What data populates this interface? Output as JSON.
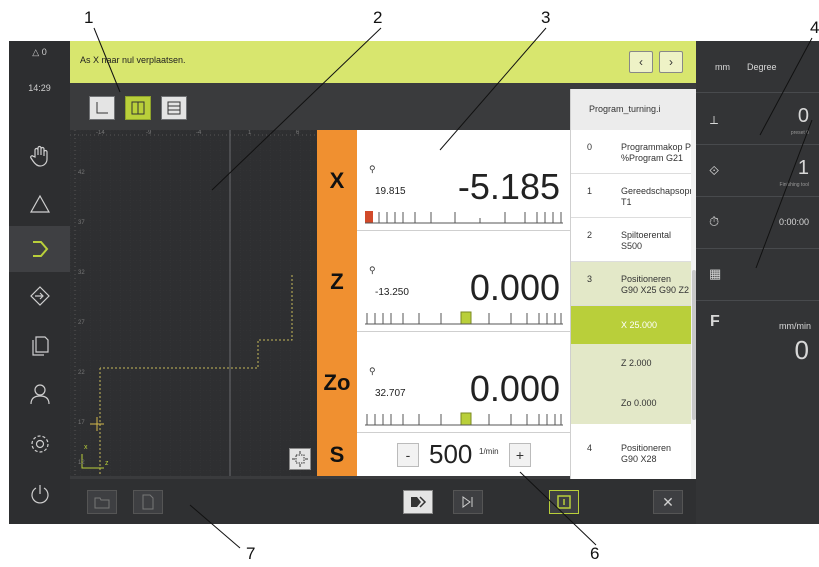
{
  "callouts": [
    "1",
    "2",
    "3",
    "4",
    "5",
    "6",
    "7"
  ],
  "status": {
    "alarm_count": "0",
    "time": "14:29"
  },
  "message": {
    "text": "As X naar nul verplaatsen."
  },
  "units": {
    "length": "mm",
    "angle": "Degree"
  },
  "right_panel": {
    "preset": {
      "value": "0",
      "label": "preset 0"
    },
    "tool": {
      "value": "1",
      "label": "Finishing tool"
    },
    "timer": {
      "value": "0:00:00"
    },
    "feed": {
      "letter": "F",
      "unit": "mm/min",
      "value": "0"
    }
  },
  "axes": [
    {
      "name": "X",
      "ref": "19.815",
      "value": "-5.185"
    },
    {
      "name": "Z",
      "ref": "-13.250",
      "value": "0.000"
    },
    {
      "name": "Zo",
      "ref": "32.707",
      "value": "0.000"
    }
  ],
  "spindle": {
    "name": "S",
    "minus": "-",
    "value": "500",
    "unit": "1/min",
    "plus": "+"
  },
  "program": {
    "title": "Program_turning.i",
    "steps": [
      {
        "num": "0",
        "line1": "Programmakop Pro",
        "line2": "%Program G21"
      },
      {
        "num": "1",
        "line1": "Gereedschapsopro",
        "line2": "T1"
      },
      {
        "num": "2",
        "line1": "Spiltoerental",
        "line2": "S500"
      },
      {
        "num": "3",
        "line1": "Positioneren",
        "line2": "G90 X25 G90 Z2 G"
      },
      {
        "num": "4",
        "line1": "Positioneren",
        "line2": "G90 X28"
      }
    ],
    "substeps": [
      "X 25.000",
      "Z 2.000",
      "Zo 0.000"
    ]
  },
  "sim": {
    "ruler_top": [
      "-14",
      "-9",
      "-4",
      "1",
      "6"
    ],
    "ruler_left": [
      "42",
      "37",
      "32",
      "27",
      "22",
      "17",
      "12"
    ],
    "axis_x": "x",
    "axis_z": "z"
  },
  "colors": {
    "accent": "#d8e66e",
    "axis": "#f09030",
    "selected": "#b9cf3a",
    "dark": "#3a3b3d"
  }
}
